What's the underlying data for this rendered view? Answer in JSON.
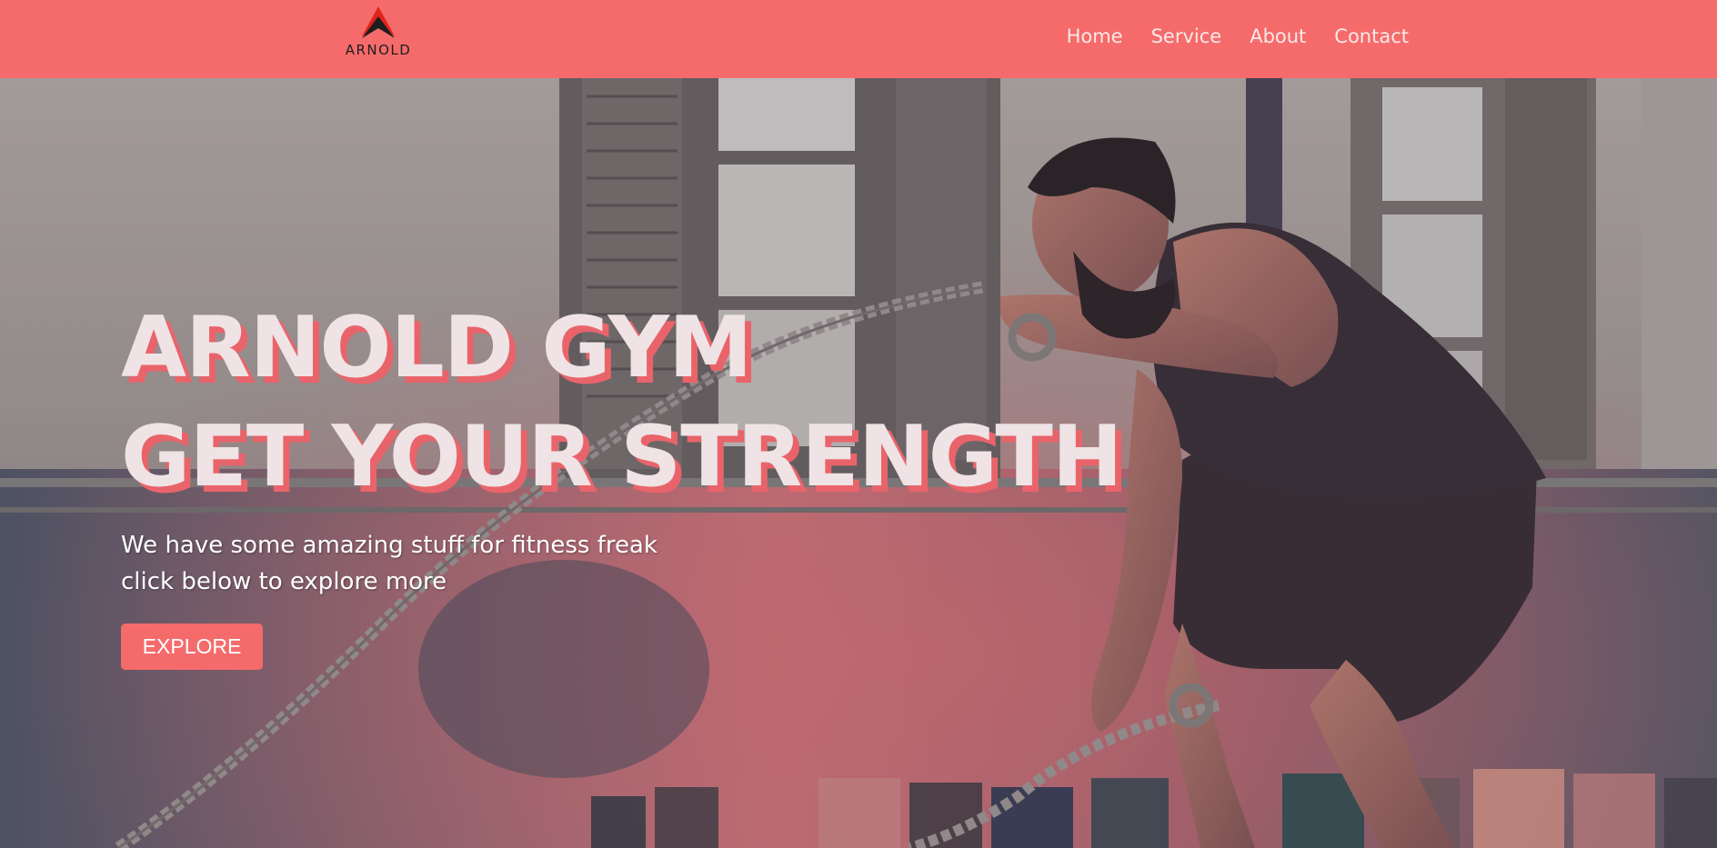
{
  "brand": {
    "logo_text": "ARNOLD",
    "logo_icon": "arnold-chevron-logo",
    "color": "#f56b6b"
  },
  "nav": {
    "items": [
      {
        "label": "Home"
      },
      {
        "label": "Service"
      },
      {
        "label": "About"
      },
      {
        "label": "Contact"
      }
    ]
  },
  "hero": {
    "title_line1": "ARNOLD GYM",
    "title_line2": "GET YOUR STRENGTH",
    "subtitle_line1": "We have some amazing stuff for fitness freak",
    "subtitle_line2": "click below to explore more",
    "cta_label": "EXPLORE",
    "background_image": "man-training-with-battle-ropes-in-gym"
  }
}
